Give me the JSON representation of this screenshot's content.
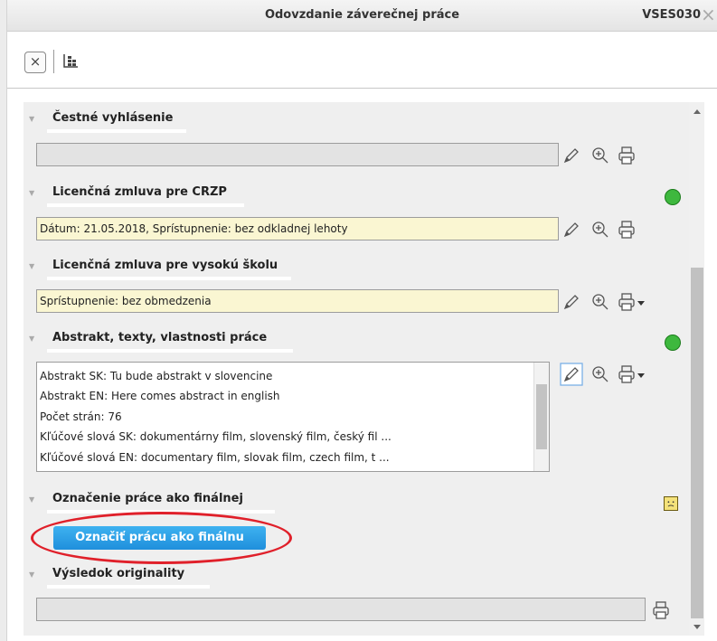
{
  "window": {
    "title": "Odovzdanie záverečnej práce",
    "code": "VSES030",
    "close_glyph": "×"
  },
  "toolbar": {
    "close_glyph": "×"
  },
  "sections": {
    "s1": {
      "title": "Čestné vyhlásenie",
      "value": ""
    },
    "s2": {
      "title": "Licenčná zmluva pre CRZP",
      "value": "Dátum: 21.05.2018, Sprístupnenie: bez odkladnej lehoty"
    },
    "s3": {
      "title": "Licenčná zmluva pre vysokú školu",
      "value": "Sprístupnenie: bez obmedzenia"
    },
    "s4": {
      "title": "Abstrakt, texty, vlastnosti práce",
      "lines": [
        "Abstrakt SK: Tu bude abstrakt v slovencine",
        "Abstrakt EN: Here comes abstract in english",
        "Počet strán: 76",
        "Kľúčové slová SK: dokumentárny film, slovenský film, český fil ...",
        "Kľúčové slová EN: documentary film, slovak film, czech film, t ..."
      ]
    },
    "s5": {
      "title": "Označenie práce ako finálnej",
      "button_label": "Označiť prácu ako finálnu"
    },
    "s6": {
      "title": "Výsledok originality",
      "value": ""
    }
  },
  "colors": {
    "field_yellow": "#faf6d2",
    "button_blue": "#1f8fdc",
    "status_ok": "#3eb83e",
    "status_warn": "#f4e27a",
    "annotation_red": "#e0202a"
  },
  "icons": [
    "close-icon",
    "tree-icon",
    "pencil-icon",
    "zoom-in-icon",
    "printer-icon",
    "smiley-happy-icon",
    "smiley-sad-icon"
  ]
}
